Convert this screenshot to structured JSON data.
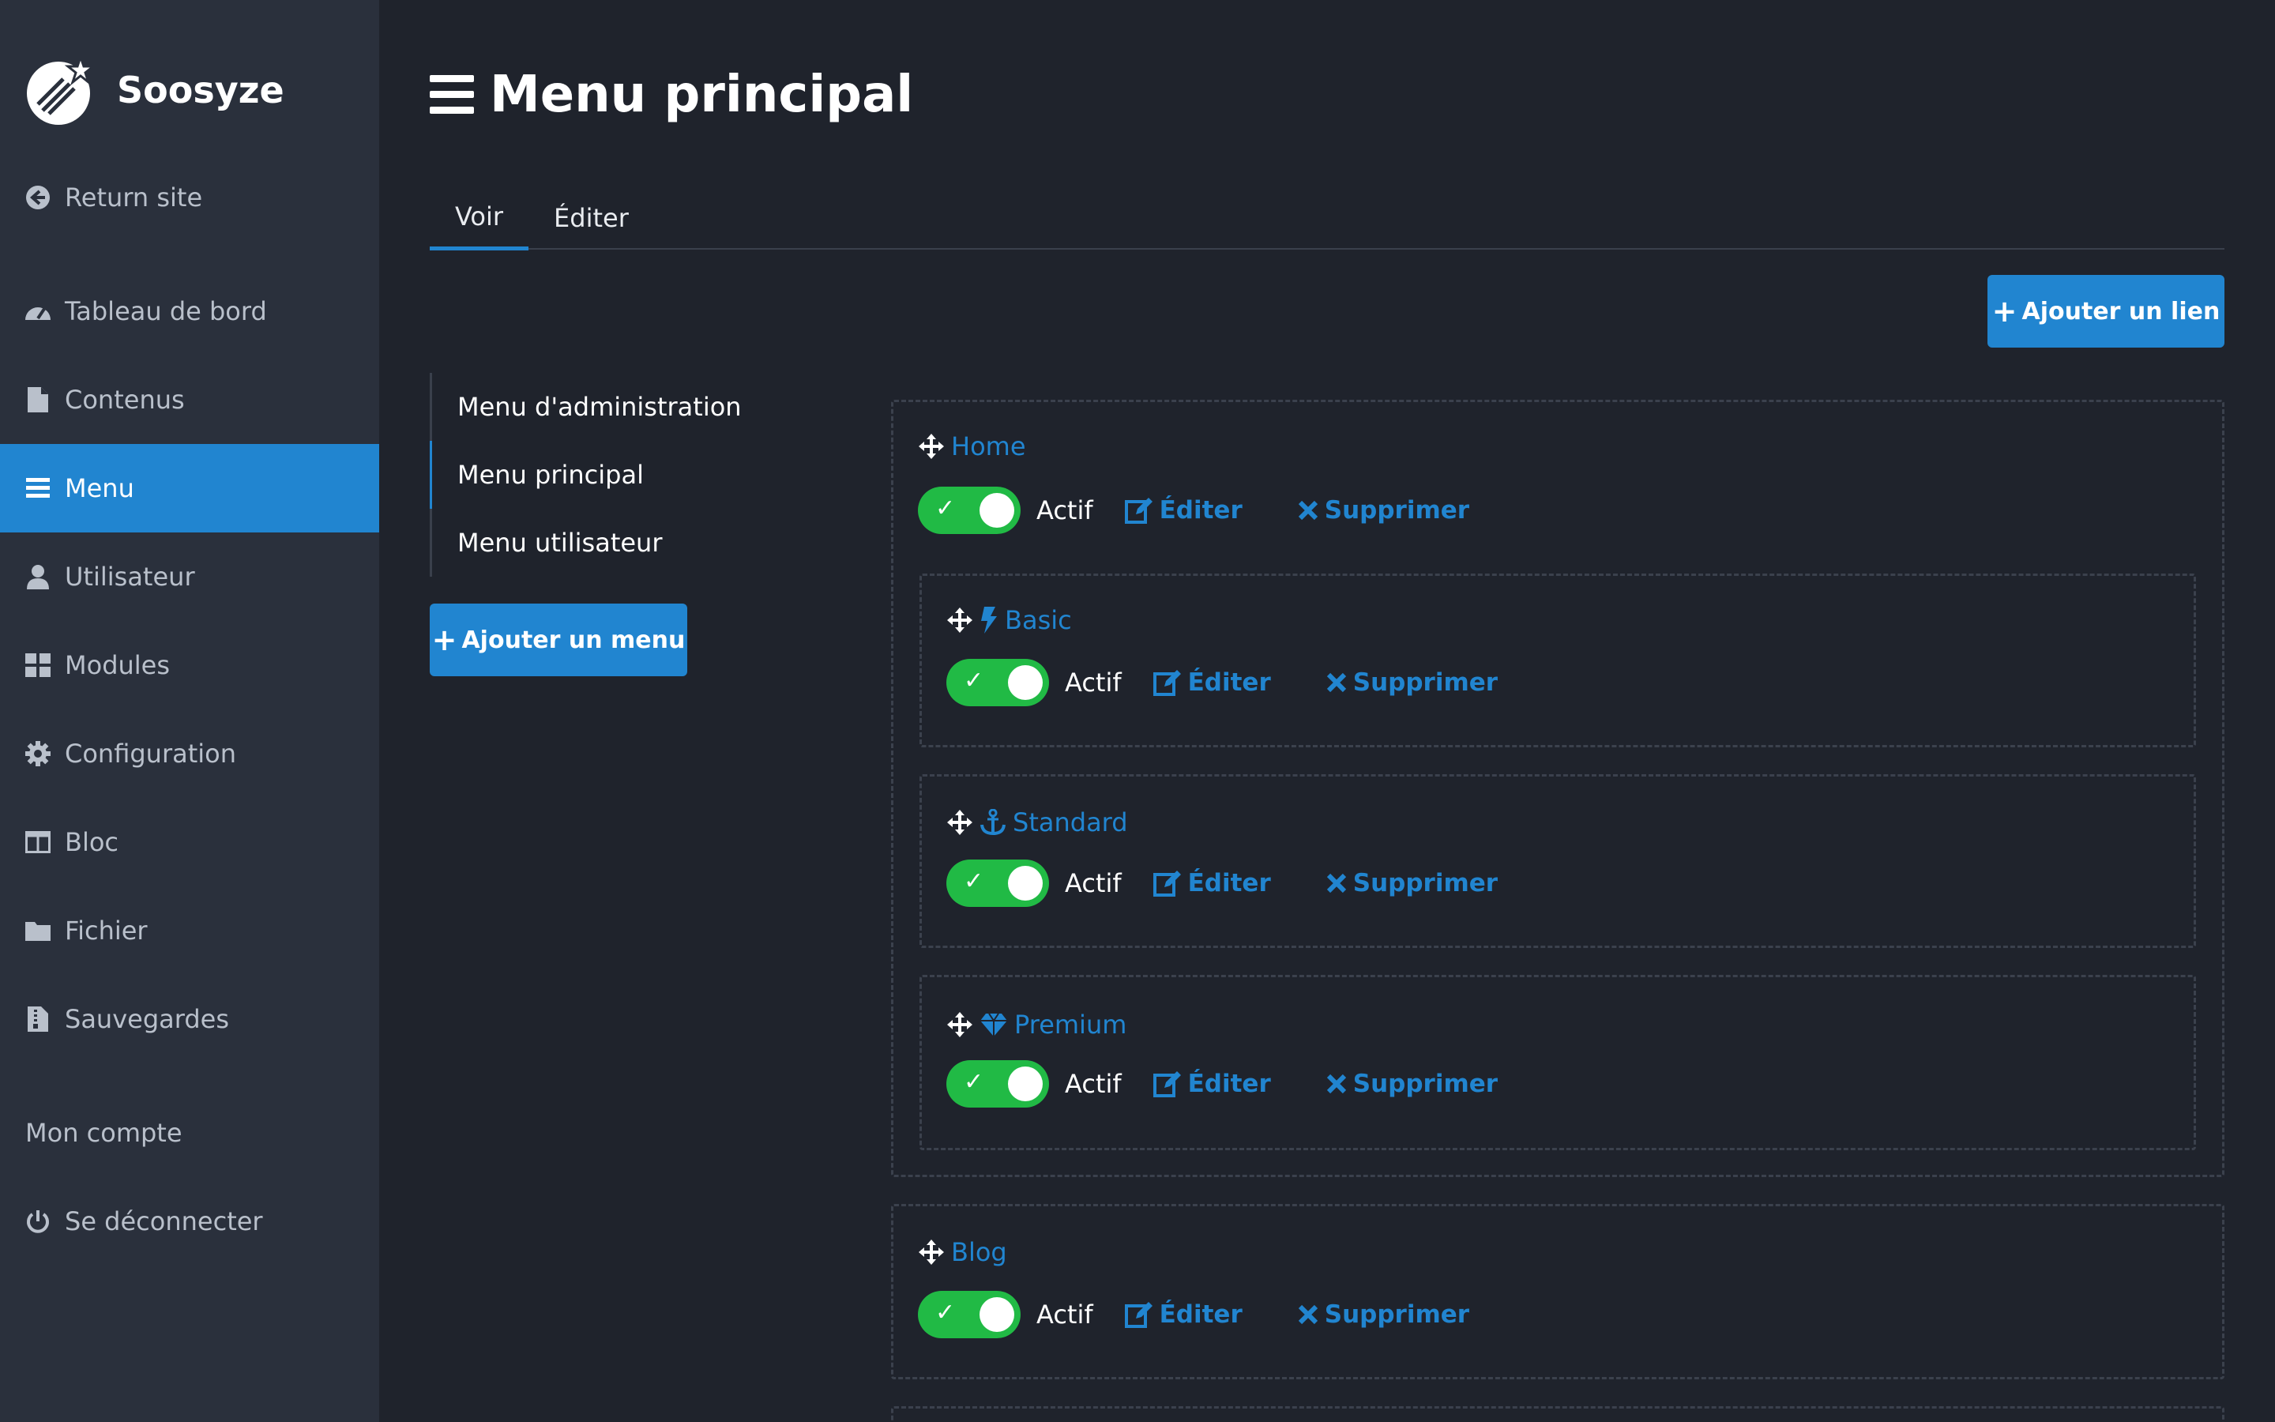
{
  "brand": {
    "name": "Soosyze"
  },
  "sidebar": {
    "return_label": "Return site",
    "items": [
      {
        "label": "Tableau de bord",
        "icon": "dashboard-icon"
      },
      {
        "label": "Contenus",
        "icon": "file-icon"
      },
      {
        "label": "Menu",
        "icon": "bars-icon",
        "active": true
      },
      {
        "label": "Utilisateur",
        "icon": "user-icon"
      },
      {
        "label": "Modules",
        "icon": "grid-icon"
      },
      {
        "label": "Configuration",
        "icon": "gear-icon"
      },
      {
        "label": "Bloc",
        "icon": "columns-icon"
      },
      {
        "label": "Fichier",
        "icon": "folder-icon"
      },
      {
        "label": "Sauvegardes",
        "icon": "archive-icon"
      }
    ],
    "account_label": "Mon compte",
    "logout_label": "Se déconnecter"
  },
  "page": {
    "title": "Menu principal"
  },
  "tabs": [
    {
      "label": "Voir",
      "active": true
    },
    {
      "label": "Éditer",
      "active": false
    }
  ],
  "add_link_label": "Ajouter un lien",
  "menus": [
    {
      "label": "Menu d'administration"
    },
    {
      "label": "Menu principal",
      "active": true
    },
    {
      "label": "Menu utilisateur"
    }
  ],
  "add_menu_label": "Ajouter un menu",
  "links": [
    {
      "title": "Home",
      "status": "Actif",
      "edit": "Éditer",
      "delete": "Supprimer"
    },
    {
      "title": "Basic",
      "icon": "bolt-icon",
      "status": "Actif",
      "edit": "Éditer",
      "delete": "Supprimer"
    },
    {
      "title": "Standard",
      "icon": "anchor-icon",
      "status": "Actif",
      "edit": "Éditer",
      "delete": "Supprimer"
    },
    {
      "title": "Premium",
      "icon": "gem-icon",
      "status": "Actif",
      "edit": "Éditer",
      "delete": "Supprimer"
    },
    {
      "title": "Blog",
      "status": "Actif",
      "edit": "Éditer",
      "delete": "Supprimer"
    }
  ],
  "colors": {
    "accent": "#2185d0",
    "toggle_on": "#21ba45",
    "sidebar_bg": "#2a303c",
    "page_bg": "#1f232c"
  }
}
